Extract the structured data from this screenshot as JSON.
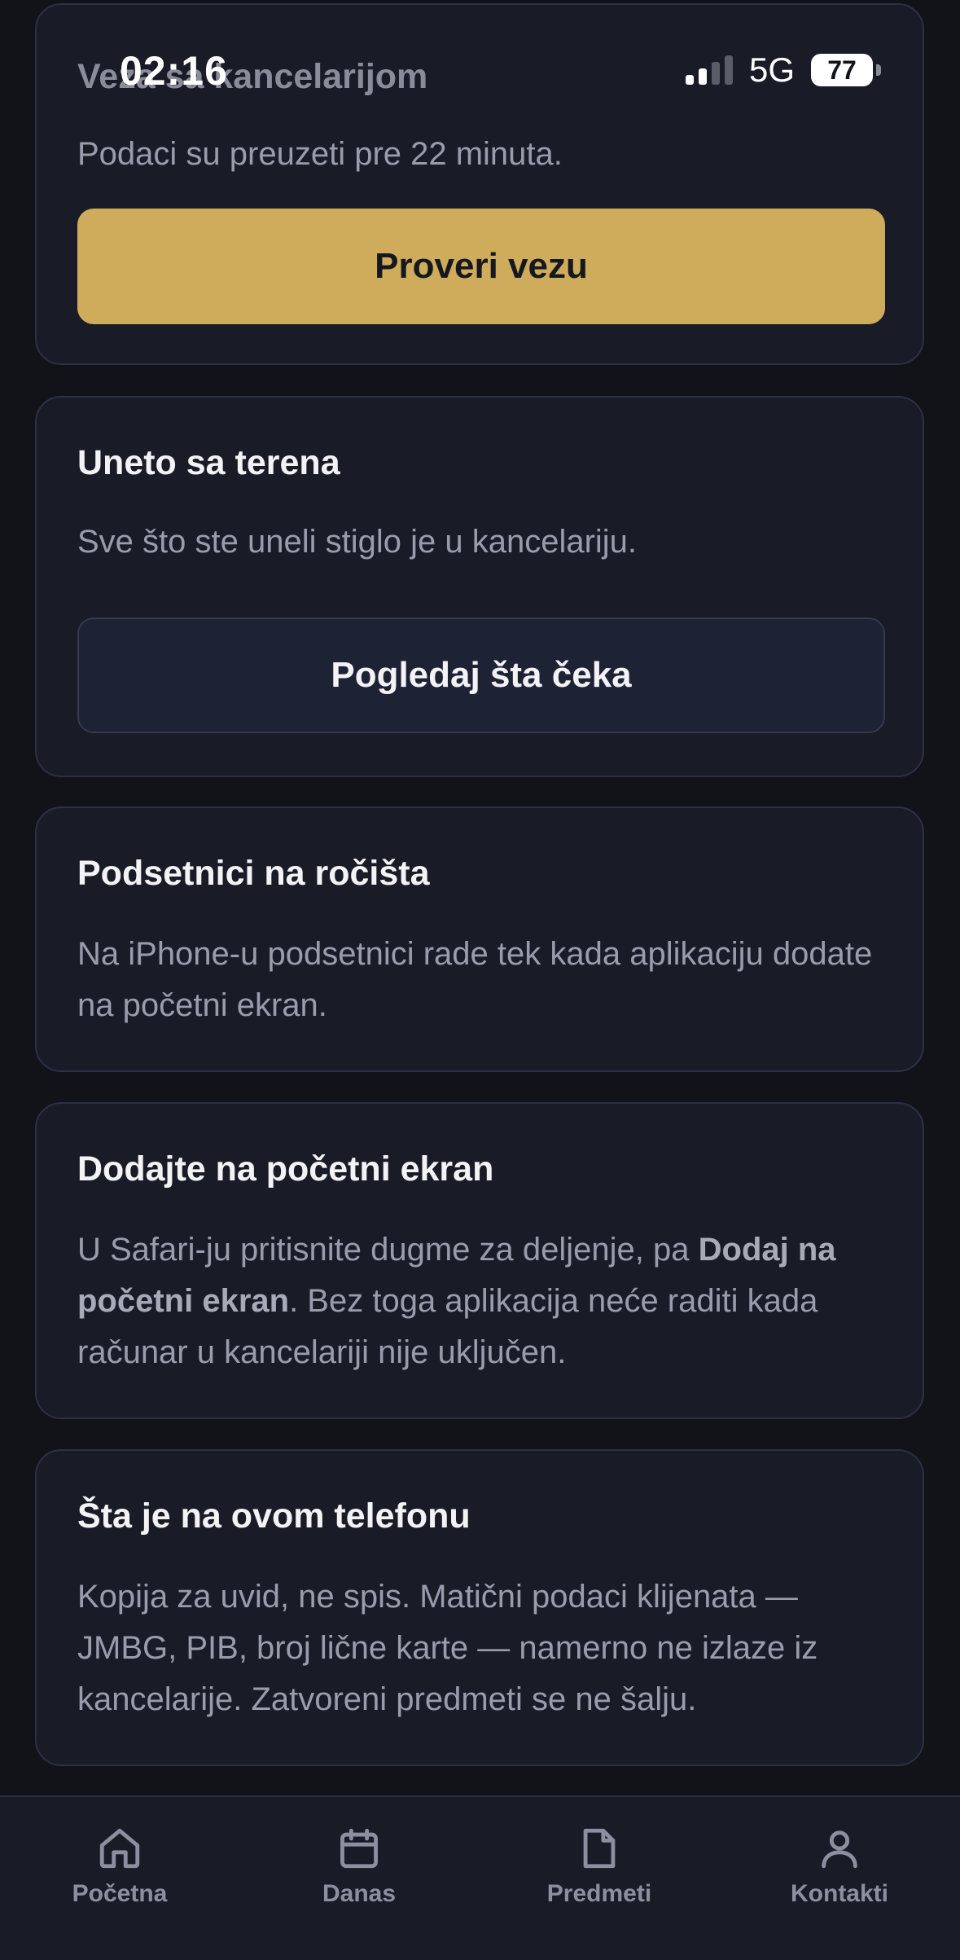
{
  "status_bar": {
    "time": "02:16",
    "network": "5G",
    "battery": "77"
  },
  "cards": {
    "connection": {
      "title": "Veza sa kancelarijom",
      "text": "Podaci su preuzeti pre 22 minuta.",
      "button": "Proveri vezu"
    },
    "field": {
      "title": "Uneto sa terena",
      "text": "Sve što ste uneli stiglo je u kancelariju.",
      "button": "Pogledaj šta čeka"
    },
    "reminders": {
      "title": "Podsetnici na ročišta",
      "text": "Na iPhone-u podsetnici rade tek kada aplikaciju dodate na početni ekran."
    },
    "homescreen": {
      "title": "Dodajte na početni ekran",
      "text_before": "U Safari-ju pritisnite dugme za deljenje, pa ",
      "text_bold": "Dodaj na početni ekran",
      "text_after": ". Bez toga aplikacija neće raditi kada računar u kancelariji nije uključen."
    },
    "phone": {
      "title": "Šta je na ovom telefonu",
      "text": "Kopija za uvid, ne spis. Matični podaci klijenata — JMBG, PIB, broj lične karte — namerno ne izlaze iz kancelarije. Zatvoreni predmeti se ne šalju."
    }
  },
  "nav": {
    "items": [
      {
        "label": "Početna",
        "icon": "home-icon"
      },
      {
        "label": "Danas",
        "icon": "calendar-icon"
      },
      {
        "label": "Predmeti",
        "icon": "document-icon"
      },
      {
        "label": "Kontakti",
        "icon": "person-icon"
      }
    ]
  },
  "colors": {
    "background": "#111318",
    "card": "#191c27",
    "accent": "#cfab5c"
  }
}
